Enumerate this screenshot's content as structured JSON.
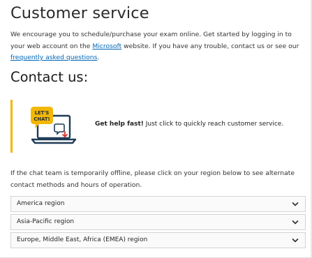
{
  "header": {
    "title": "Customer service"
  },
  "intro": {
    "text_before": "We encourage you to schedule/purchase your exam online. Get started by logging in to your web account on the ",
    "link_microsoft": "Microsoft",
    "text_middle": " website. If you have any trouble, contact us or see our ",
    "link_faq": "frequently asked questions",
    "text_after": "."
  },
  "contact": {
    "heading": "Contact us:",
    "chat_card": {
      "badge_line1": "LET'S",
      "badge_line2": "CHAT!",
      "bold": "Get help fast!",
      "text": " Just click to quickly reach customer service.",
      "accent_color": "#f2b705",
      "icon": "laptop-chat-icon"
    }
  },
  "offline": {
    "text": "If the chat team is temporarily offline, please click on your region below to see alternate contact methods and hours of operation."
  },
  "regions": [
    {
      "label": "America region"
    },
    {
      "label": "Asia-Pacific region"
    },
    {
      "label": "Europe, Middle East, Africa (EMEA) region"
    }
  ],
  "colors": {
    "link": "#0067b8",
    "badge_fill": "#f2b705",
    "laptop_outline": "#1f3b57",
    "download_arrow": "#d9302c"
  }
}
